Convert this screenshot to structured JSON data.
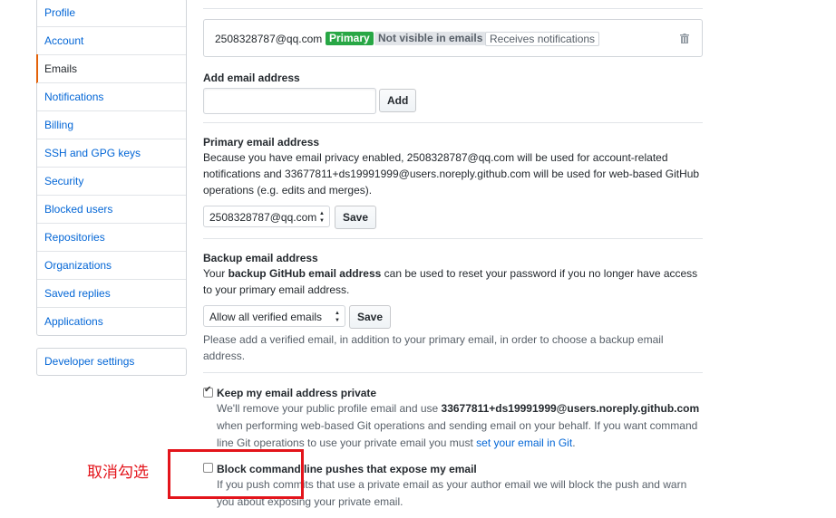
{
  "sidebar": {
    "items": [
      {
        "label": "Profile"
      },
      {
        "label": "Account"
      },
      {
        "label": "Emails",
        "selected": true
      },
      {
        "label": "Notifications"
      },
      {
        "label": "Billing"
      },
      {
        "label": "SSH and GPG keys"
      },
      {
        "label": "Security"
      },
      {
        "label": "Blocked users"
      },
      {
        "label": "Repositories"
      },
      {
        "label": "Organizations"
      },
      {
        "label": "Saved replies"
      },
      {
        "label": "Applications"
      }
    ],
    "developer_settings": "Developer settings"
  },
  "email_list": {
    "address": "2508328787@qq.com",
    "primary_label": "Primary",
    "visibility_label": "Not visible in emails",
    "notifications_label": "Receives notifications",
    "delete_icon": "trash-icon"
  },
  "add_email": {
    "heading": "Add email address",
    "input_value": "",
    "button": "Add"
  },
  "primary_email": {
    "heading": "Primary email address",
    "text_before": "Because you have email privacy enabled, 2508328787@qq.com will be used for account-related notifications and 33677811+ds19991999@users.noreply.github.com will be used for web-based GitHub operations (e.g. edits and merges).",
    "select_value": "2508328787@qq.com",
    "button": "Save"
  },
  "backup_email": {
    "heading": "Backup email address",
    "text_1": "Your ",
    "text_bold": "backup GitHub email address",
    "text_2": " can be used to reset your password if you no longer have access to your primary email address.",
    "select_value": "Allow all verified emails",
    "button": "Save",
    "note": "Please add a verified email, in addition to your primary email, in order to choose a backup email address."
  },
  "keep_private": {
    "checked": true,
    "label": "Keep my email address private",
    "note_1": "We'll remove your public profile email and use ",
    "note_bold": "33677811+ds19991999@users.noreply.github.com",
    "note_2": " when performing web-based Git operations and sending email on your behalf. If you want command line Git operations to use your private email you must ",
    "note_link": "set your email in Git",
    "note_3": "."
  },
  "block_push": {
    "checked": false,
    "label": "Block command line pushes that expose my email",
    "note": "If you push commits that use a private email as your author email we will block the push and warn you about exposing your private email."
  },
  "annotation": {
    "text": "取消勾选",
    "color": "#e3141b"
  }
}
